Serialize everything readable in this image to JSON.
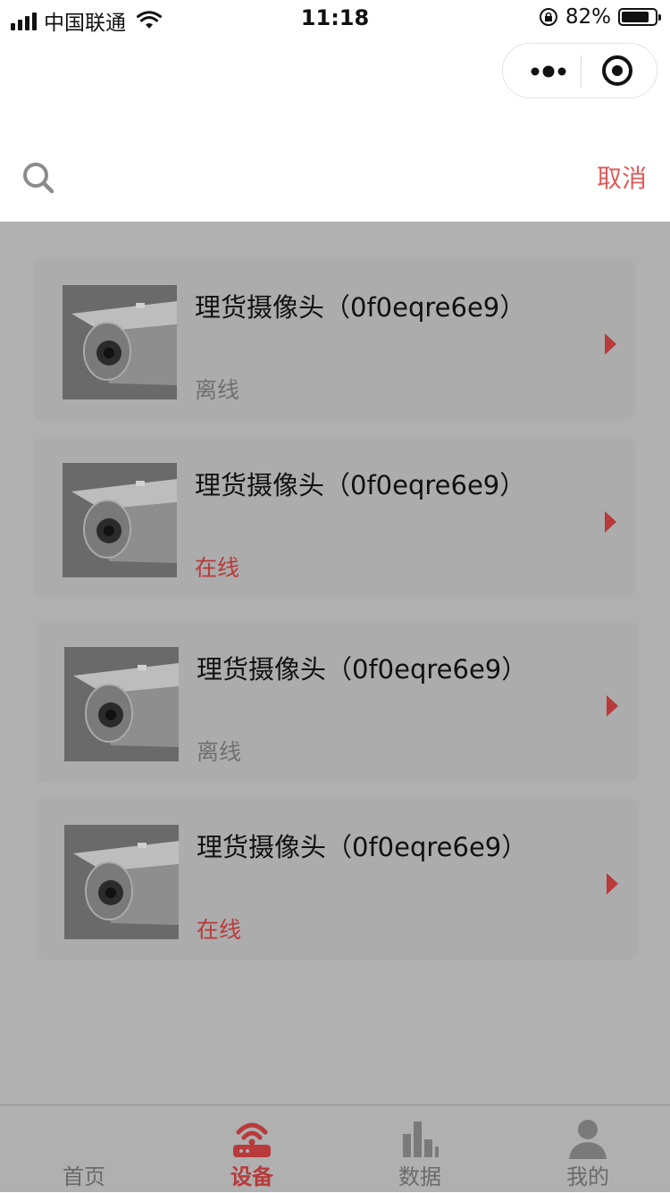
{
  "status_bar": {
    "carrier": "中国联通",
    "time": "11:18",
    "battery": "82%",
    "battery_level": 0.82
  },
  "search": {
    "placeholder": "",
    "cancel_label": "取消"
  },
  "devices": [
    {
      "name": "理货摄像头（0f0eqre6e9）",
      "status": "离线",
      "online": false
    },
    {
      "name": "理货摄像头（0f0eqre6e9）",
      "status": "在线",
      "online": true
    },
    {
      "name": "理货摄像头（0f0eqre6e9）",
      "status": "离线",
      "online": false
    },
    {
      "name": "理货摄像头（0f0eqre6e9）",
      "status": "在线",
      "online": true
    }
  ],
  "tabbar": {
    "items": [
      {
        "label": "首页",
        "icon": "home-icon",
        "active": false
      },
      {
        "label": "设备",
        "icon": "router-icon",
        "active": true
      },
      {
        "label": "数据",
        "icon": "bar-chart-icon",
        "active": false
      },
      {
        "label": "我的",
        "icon": "user-icon",
        "active": false
      }
    ]
  },
  "colors": {
    "accent": "#b83a3a",
    "cancel": "#e05a5a",
    "overlay_bg": "#b0b0b0",
    "card_bg": "#acacac"
  }
}
